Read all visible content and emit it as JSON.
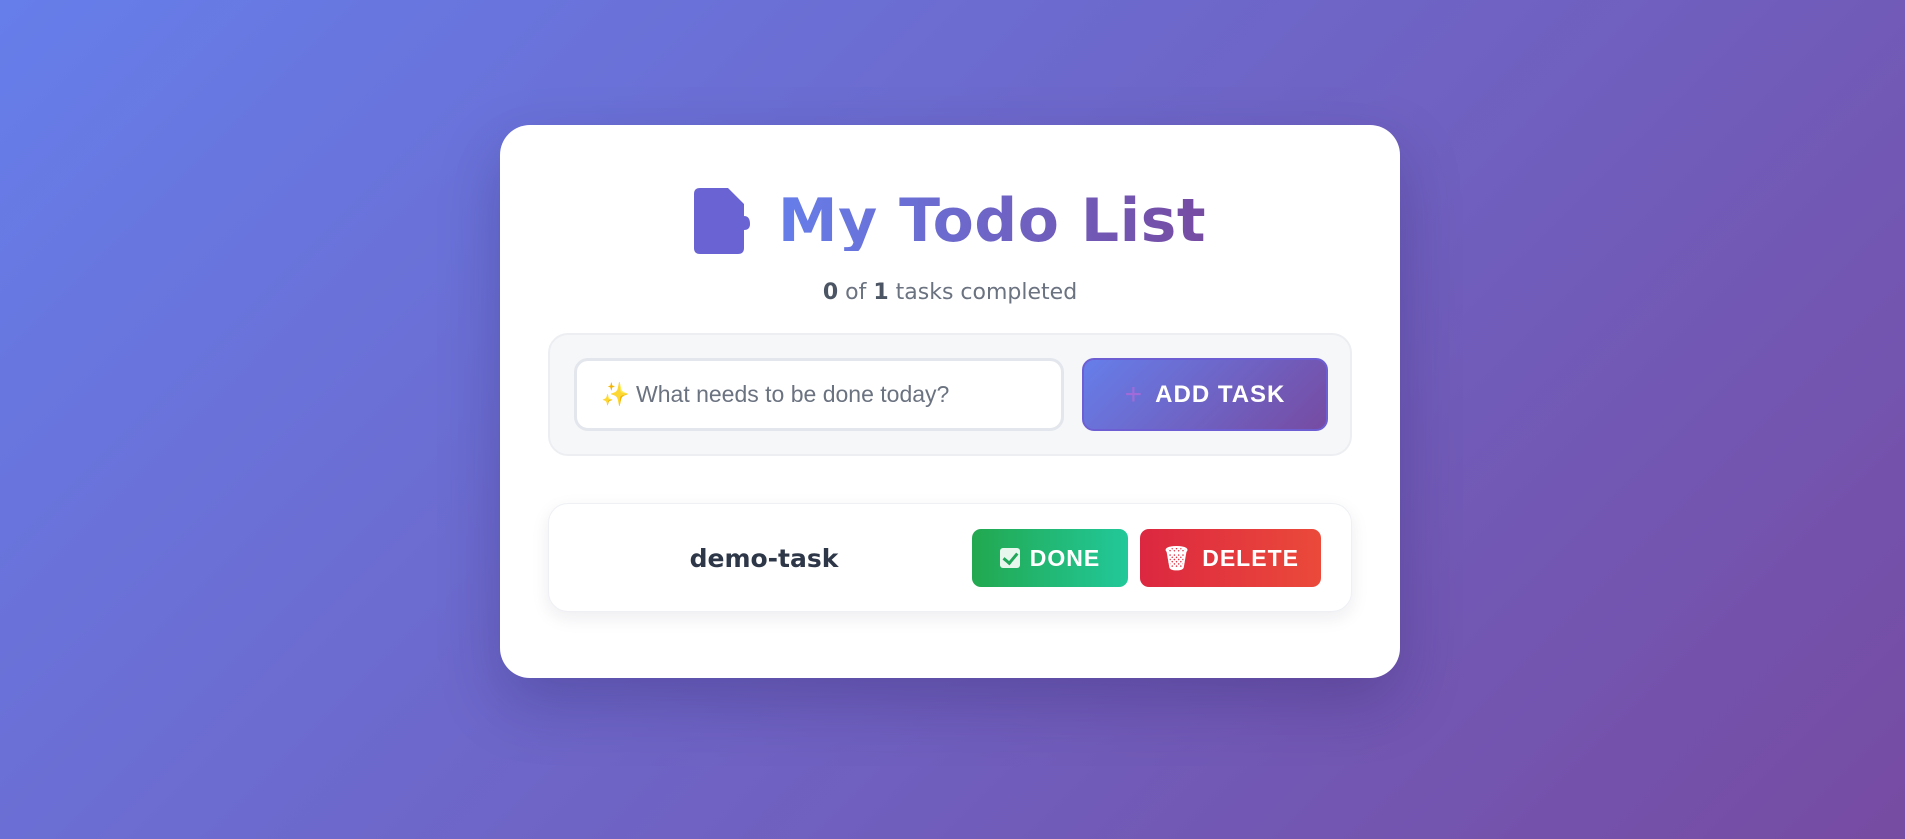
{
  "header": {
    "title": "My Todo List",
    "icon": "document-icon",
    "accent_color": "#6a5cc8"
  },
  "stats": {
    "completed": "0",
    "of_label": "of",
    "total": "1",
    "suffix": "tasks completed"
  },
  "add_form": {
    "placeholder": "✨ What needs to be done today?",
    "value": "",
    "button_icon": "sparkle-plus-icon",
    "button_icon_glyph": "+",
    "button_label": "ADD TASK"
  },
  "tasks": [
    {
      "text": "demo-task",
      "done_icon": "check-box-icon",
      "done_label": "DONE",
      "delete_icon": "wastebasket-icon",
      "delete_icon_glyph": "🗑",
      "delete_label": "DELETE"
    }
  ],
  "colors": {
    "background_start": "#667eea",
    "background_end": "#764ba2",
    "done_button": "#22b36a",
    "delete_button": "#e2333d"
  }
}
